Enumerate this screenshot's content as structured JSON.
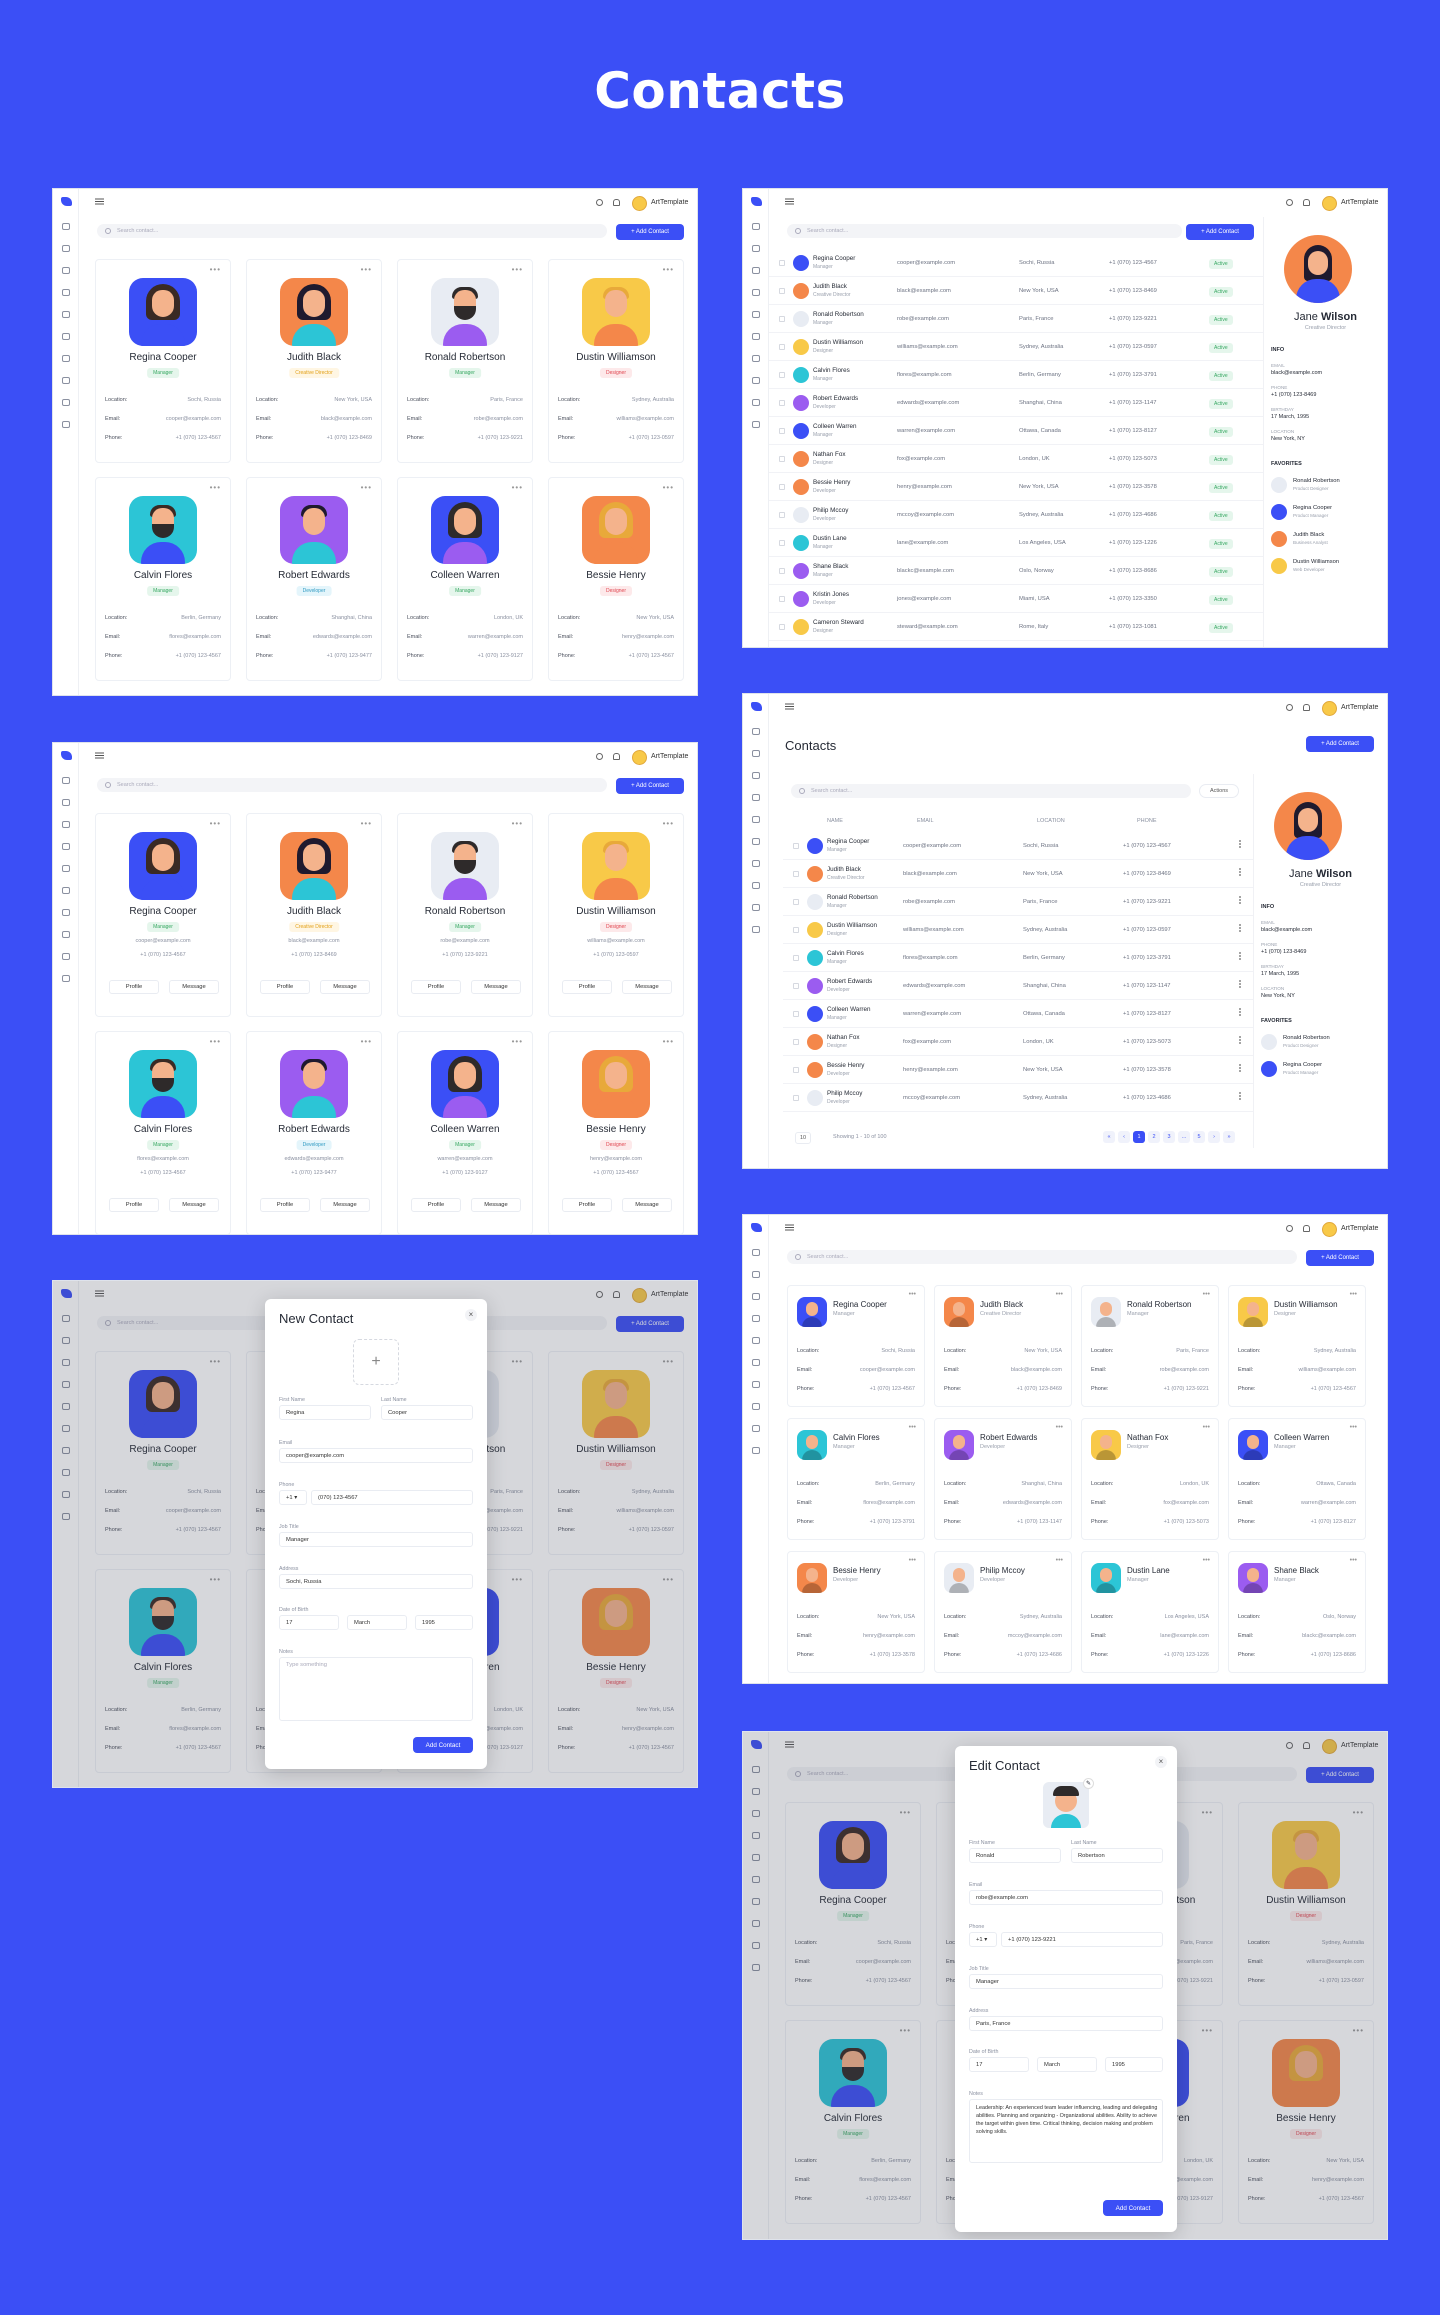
{
  "page": {
    "title": "Contacts"
  },
  "app": {
    "user": "ArtTemplate",
    "search_placeholder": "Search contact...",
    "add_contact": "+ Add Contact",
    "contacts_heading": "Contacts",
    "actions_label": "Actions",
    "page_size": "10",
    "showing": "Showing 1 - 10 of 100",
    "pages": [
      "«",
      "‹",
      "1",
      "2",
      "3",
      "...",
      "5",
      "›",
      "»"
    ],
    "col_headers": [
      "NAME",
      "EMAIL",
      "LOCATION",
      "PHONE"
    ],
    "profile_label": "Profile",
    "message_label": "Message",
    "status_active": "Active"
  },
  "labels": {
    "location": "Location:",
    "email": "Email:",
    "phone": "Phone:"
  },
  "contacts": [
    {
      "name": "Regina Cooper",
      "role": "Manager",
      "location": "Sochi, Russia",
      "email": "cooper@example.com",
      "phone": "+1 (070) 123-4567",
      "color": "#3b4ff6"
    },
    {
      "name": "Judith Black",
      "role": "Creative Director",
      "location": "New York, USA",
      "email": "black@example.com",
      "phone": "+1 (070) 123-8469",
      "color": "#f4874a"
    },
    {
      "name": "Ronald Robertson",
      "role": "Manager",
      "location": "Paris, France",
      "email": "robe@example.com",
      "phone": "+1 (070) 123-9221",
      "color": "#e8ecf3"
    },
    {
      "name": "Dustin Williamson",
      "role": "Designer",
      "location": "Sydney, Australia",
      "email": "williams@example.com",
      "phone": "+1 (070) 123-0597",
      "color": "#f8c948"
    },
    {
      "name": "Calvin Flores",
      "role": "Manager",
      "location": "Berlin, Germany",
      "email": "flores@example.com",
      "phone": "+1 (070) 123-4567",
      "color": "#2cc5d6"
    },
    {
      "name": "Robert Edwards",
      "role": "Developer",
      "location": "Shanghai, China",
      "email": "edwards@example.com",
      "phone": "+1 (070) 123-9477",
      "color": "#9b5cf0"
    },
    {
      "name": "Colleen Warren",
      "role": "Manager",
      "location": "London, UK",
      "email": "warren@example.com",
      "phone": "+1 (070) 123-9127",
      "color": "#3b4ff6"
    },
    {
      "name": "Bessie Henry",
      "role": "Designer",
      "location": "New York, USA",
      "email": "henry@example.com",
      "phone": "+1 (070) 123-4567",
      "color": "#f4874a"
    }
  ],
  "table_rows": [
    {
      "name": "Regina Cooper",
      "role": "Manager",
      "email": "cooper@example.com",
      "location": "Sochi, Russia",
      "phone": "+1 (070) 123-4567"
    },
    {
      "name": "Judith Black",
      "role": "Creative Director",
      "email": "black@example.com",
      "location": "New York, USA",
      "phone": "+1 (070) 123-8469"
    },
    {
      "name": "Ronald Robertson",
      "role": "Manager",
      "email": "robe@example.com",
      "location": "Paris, France",
      "phone": "+1 (070) 123-9221"
    },
    {
      "name": "Dustin Williamson",
      "role": "Designer",
      "email": "williams@example.com",
      "location": "Sydney, Australia",
      "phone": "+1 (070) 123-0597"
    },
    {
      "name": "Calvin Flores",
      "role": "Manager",
      "email": "flores@example.com",
      "location": "Berlin, Germany",
      "phone": "+1 (070) 123-3791"
    },
    {
      "name": "Robert Edwards",
      "role": "Developer",
      "email": "edwards@example.com",
      "location": "Shanghai, China",
      "phone": "+1 (070) 123-1147"
    },
    {
      "name": "Colleen Warren",
      "role": "Manager",
      "email": "warren@example.com",
      "location": "Ottawa, Canada",
      "phone": "+1 (070) 123-8127"
    },
    {
      "name": "Nathan Fox",
      "role": "Designer",
      "email": "fox@example.com",
      "location": "London, UK",
      "phone": "+1 (070) 123-5073"
    },
    {
      "name": "Bessie Henry",
      "role": "Developer",
      "email": "henry@example.com",
      "location": "New York, USA",
      "phone": "+1 (070) 123-3578"
    },
    {
      "name": "Philip Mccoy",
      "role": "Developer",
      "email": "mccoy@example.com",
      "location": "Sydney, Australia",
      "phone": "+1 (070) 123-4686"
    },
    {
      "name": "Dustin Lane",
      "role": "Manager",
      "email": "lane@example.com",
      "location": "Los Angeles, USA",
      "phone": "+1 (070) 123-1226"
    },
    {
      "name": "Shane Black",
      "role": "Manager",
      "email": "blackc@example.com",
      "location": "Oslo, Norway",
      "phone": "+1 (070) 123-8686"
    },
    {
      "name": "Kristin Jones",
      "role": "Developer",
      "email": "jones@example.com",
      "location": "Miami, USA",
      "phone": "+1 (070) 123-3350"
    },
    {
      "name": "Cameron Steward",
      "role": "Designer",
      "email": "steward@example.com",
      "location": "Rome, Italy",
      "phone": "+1 (070) 123-1081"
    }
  ],
  "profile": {
    "first": "Jane",
    "last": "Wilson",
    "role": "Creative Director",
    "info_title": "INFO",
    "email_label": "EMAIL",
    "email": "black@example.com",
    "phone_label": "PHONE",
    "phone": "+1 (070) 123-8469",
    "birthday_label": "BIRTHDAY",
    "birthday": "17 March, 1995",
    "location_label": "LOCATION",
    "location": "New York, NY",
    "favorites_title": "FAVORITES",
    "favorites": [
      {
        "name": "Ronald Robertson",
        "role": "Product Designer"
      },
      {
        "name": "Regina Cooper",
        "role": "Product Manager"
      },
      {
        "name": "Judith Black",
        "role": "Business Analyst"
      },
      {
        "name": "Dustin Williamson",
        "role": "Web Developer"
      }
    ]
  },
  "grid_contacts": [
    {
      "name": "Regina Cooper",
      "role": "Manager",
      "location": "Sochi, Russia",
      "email": "cooper@example.com",
      "phone": "+1 (070) 123-4567"
    },
    {
      "name": "Judith Black",
      "role": "Creative Director",
      "location": "New York, USA",
      "email": "black@example.com",
      "phone": "+1 (070) 123-8469"
    },
    {
      "name": "Ronald Robertson",
      "role": "Manager",
      "location": "Paris, France",
      "email": "robe@example.com",
      "phone": "+1 (070) 123-9221"
    },
    {
      "name": "Dustin Williamson",
      "role": "Designer",
      "location": "Sydney, Australia",
      "email": "williams@example.com",
      "phone": "+1 (070) 123-4567"
    },
    {
      "name": "Calvin Flores",
      "role": "Manager",
      "location": "Berlin, Germany",
      "email": "flores@example.com",
      "phone": "+1 (070) 123-3791"
    },
    {
      "name": "Robert Edwards",
      "role": "Developer",
      "location": "Shanghai, China",
      "email": "edwards@example.com",
      "phone": "+1 (070) 123-1147"
    },
    {
      "name": "Nathan Fox",
      "role": "Designer",
      "location": "London, UK",
      "email": "fox@example.com",
      "phone": "+1 (070) 123-5073"
    },
    {
      "name": "Colleen Warren",
      "role": "Manager",
      "location": "Ottawa, Canada",
      "email": "warren@example.com",
      "phone": "+1 (070) 123-8127"
    },
    {
      "name": "Bessie Henry",
      "role": "Developer",
      "location": "New York, USA",
      "email": "henry@example.com",
      "phone": "+1 (070) 123-3578"
    },
    {
      "name": "Philip Mccoy",
      "role": "Developer",
      "location": "Sydney, Australia",
      "email": "mccoy@example.com",
      "phone": "+1 (070) 123-4686"
    },
    {
      "name": "Dustin Lane",
      "role": "Manager",
      "location": "Los Angeles, USA",
      "email": "lane@example.com",
      "phone": "+1 (070) 123-1226"
    },
    {
      "name": "Shane Black",
      "role": "Manager",
      "location": "Oslo, Norway",
      "email": "blackc@example.com",
      "phone": "+1 (070) 123-8686"
    }
  ],
  "new_contact": {
    "title": "New Contact",
    "first_label": "First Name",
    "first": "Regina",
    "last_label": "Last Name",
    "last": "Cooper",
    "email_label": "Email",
    "email": "cooper@example.com",
    "phone_label": "Phone",
    "prefix": "+1 ▾",
    "phone": "(070) 123-4567",
    "job_label": "Job Title",
    "job": "Manager",
    "address_label": "Address",
    "address": "Sochi, Russia",
    "dob_label": "Date of Birth",
    "day": "17",
    "month": "March",
    "year": "1995",
    "notes_label": "Notes",
    "notes_placeholder": "Type something",
    "button": "Add Contact"
  },
  "edit_contact": {
    "title": "Edit Contact",
    "first_label": "First Name",
    "first": "Ronald",
    "last_label": "Last Name",
    "last": "Robertson",
    "email_label": "Email",
    "email": "robe@example.com",
    "phone_label": "Phone",
    "prefix": "+1 ▾",
    "phone": "+1 (070) 123-9221",
    "job_label": "Job Title",
    "job": "Manager",
    "address_label": "Address",
    "address": "Paris, France",
    "dob_label": "Date of Birth",
    "day": "17",
    "month": "March",
    "year": "1995",
    "notes_label": "Notes",
    "notes": "Leadership: An experienced team leader influencing, leading and delegating abilities. Planning and organizing - Organizational abilities. Ability to achieve the target within given time. Critical thinking, decision making and problem solving skills.",
    "button": "Add Contact"
  }
}
